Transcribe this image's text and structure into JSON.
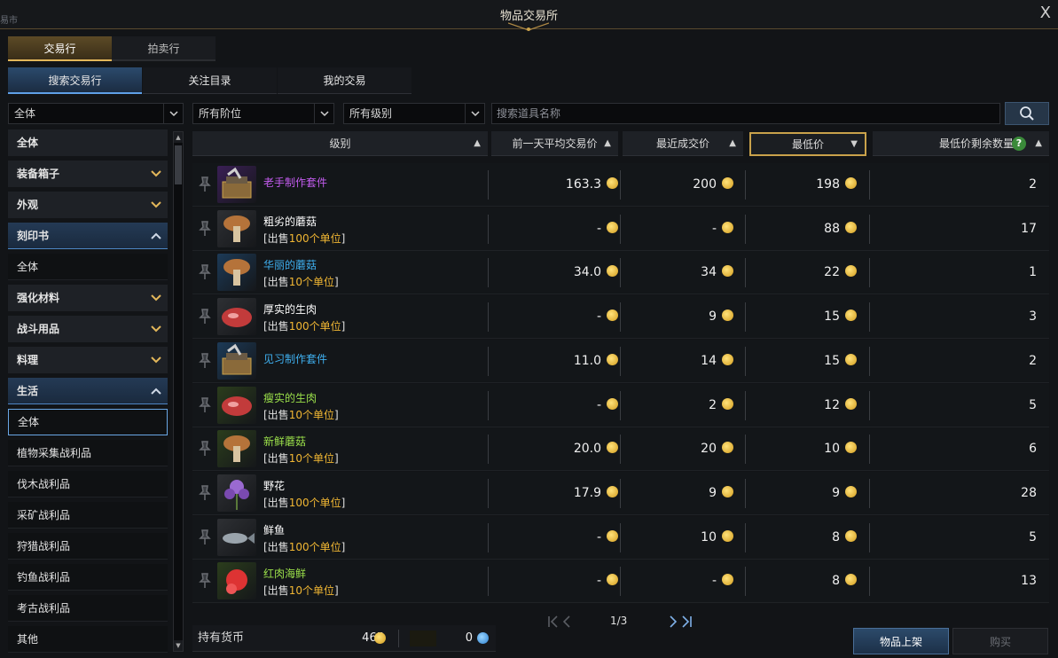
{
  "window": {
    "title": "物品交易所",
    "left_fragment": "易市",
    "close": "X"
  },
  "top_tabs": [
    {
      "label": "交易行",
      "active": true
    },
    {
      "label": "拍卖行",
      "active": false
    }
  ],
  "sub_tabs": [
    {
      "label": "搜索交易行",
      "active": true
    },
    {
      "label": "关注目录",
      "active": false
    },
    {
      "label": "我的交易",
      "active": false
    }
  ],
  "filters": {
    "category": "全体",
    "tier": "所有阶位",
    "grade": "所有级别",
    "search_placeholder": "搜索道具名称"
  },
  "sidebar": [
    {
      "label": "全体",
      "type": "cat"
    },
    {
      "label": "装备箱子",
      "type": "cat",
      "chevron": "down"
    },
    {
      "label": "外观",
      "type": "cat",
      "chevron": "down"
    },
    {
      "label": "刻印书",
      "type": "open",
      "chevron": "up"
    },
    {
      "label": "全体",
      "type": "sub"
    },
    {
      "label": "强化材料",
      "type": "cat",
      "chevron": "down"
    },
    {
      "label": "战斗用品",
      "type": "cat",
      "chevron": "down"
    },
    {
      "label": "料理",
      "type": "cat",
      "chevron": "down"
    },
    {
      "label": "生活",
      "type": "open",
      "chevron": "up"
    },
    {
      "label": "全体",
      "type": "selected"
    },
    {
      "label": "植物采集战利品",
      "type": "sub"
    },
    {
      "label": "伐木战利品",
      "type": "sub"
    },
    {
      "label": "采矿战利品",
      "type": "sub"
    },
    {
      "label": "狩猎战利品",
      "type": "sub"
    },
    {
      "label": "钓鱼战利品",
      "type": "sub"
    },
    {
      "label": "考古战利品",
      "type": "sub"
    },
    {
      "label": "其他",
      "type": "sub"
    }
  ],
  "columns": {
    "grade": "级别",
    "prev_avg": "前一天平均交易价",
    "recent": "最近成交价",
    "lowest": "最低价",
    "remaining": "最低价剩余数量",
    "help": "?"
  },
  "items": [
    {
      "name": "老手制作套件",
      "name_color": "#c45cf0",
      "unit_prefix": "",
      "unit_qty": "",
      "unit_suffix": "",
      "bg": "#3a1f55",
      "avg": "163.3",
      "recent": "200",
      "lowest": "198",
      "remaining": "2",
      "icon": "toolbox-icon"
    },
    {
      "name": "粗劣的蘑菇",
      "name_color": "#ffffff",
      "unit_prefix": "[出售",
      "unit_qty": "100个单位",
      "unit_suffix": "]",
      "bg": "#2e3034",
      "avg": "-",
      "recent": "-",
      "lowest": "88",
      "remaining": "17",
      "icon": "mushroom-icon"
    },
    {
      "name": "华丽的蘑菇",
      "name_color": "#3fb0f0",
      "unit_prefix": "[出售",
      "unit_qty": "10个单位",
      "unit_suffix": "]",
      "bg": "#1c3a57",
      "avg": "34.0",
      "recent": "34",
      "lowest": "22",
      "remaining": "1",
      "icon": "mushroom-icon"
    },
    {
      "name": "厚实的生肉",
      "name_color": "#ffffff",
      "unit_prefix": "[出售",
      "unit_qty": "100个单位",
      "unit_suffix": "]",
      "bg": "#2e3034",
      "avg": "-",
      "recent": "9",
      "lowest": "15",
      "remaining": "3",
      "icon": "meat-icon"
    },
    {
      "name": "见习制作套件",
      "name_color": "#3fb0f0",
      "unit_prefix": "",
      "unit_qty": "",
      "unit_suffix": "",
      "bg": "#1c3a57",
      "avg": "11.0",
      "recent": "14",
      "lowest": "15",
      "remaining": "2",
      "icon": "toolbox-icon"
    },
    {
      "name": "瘦实的生肉",
      "name_color": "#9be04a",
      "unit_prefix": "[出售",
      "unit_qty": "10个单位",
      "unit_suffix": "]",
      "bg": "#2b3d1c",
      "avg": "-",
      "recent": "2",
      "lowest": "12",
      "remaining": "5",
      "icon": "meat-icon"
    },
    {
      "name": "新鲜蘑菇",
      "name_color": "#9be04a",
      "unit_prefix": "[出售",
      "unit_qty": "10个单位",
      "unit_suffix": "]",
      "bg": "#2b3d1c",
      "avg": "20.0",
      "recent": "20",
      "lowest": "10",
      "remaining": "6",
      "icon": "mushroom-icon"
    },
    {
      "name": "野花",
      "name_color": "#ffffff",
      "unit_prefix": "[出售",
      "unit_qty": "100个单位",
      "unit_suffix": "]",
      "bg": "#2e3034",
      "avg": "17.9",
      "recent": "9",
      "lowest": "9",
      "remaining": "28",
      "icon": "flower-icon"
    },
    {
      "name": "鲜鱼",
      "name_color": "#ffffff",
      "unit_prefix": "[出售",
      "unit_qty": "100个单位",
      "unit_suffix": "]",
      "bg": "#2e3034",
      "avg": "-",
      "recent": "10",
      "lowest": "8",
      "remaining": "5",
      "icon": "fish-icon"
    },
    {
      "name": "红肉海鲜",
      "name_color": "#9be04a",
      "unit_prefix": "[出售",
      "unit_qty": "10个单位",
      "unit_suffix": "]",
      "bg": "#2b3d1c",
      "avg": "-",
      "recent": "-",
      "lowest": "8",
      "remaining": "13",
      "icon": "seafood-icon"
    }
  ],
  "pagination": {
    "label": "1/3"
  },
  "currency": {
    "label": "持有货币",
    "gold": "465",
    "blue": "0"
  },
  "buttons": {
    "list": "物品上架",
    "buy": "购买"
  }
}
